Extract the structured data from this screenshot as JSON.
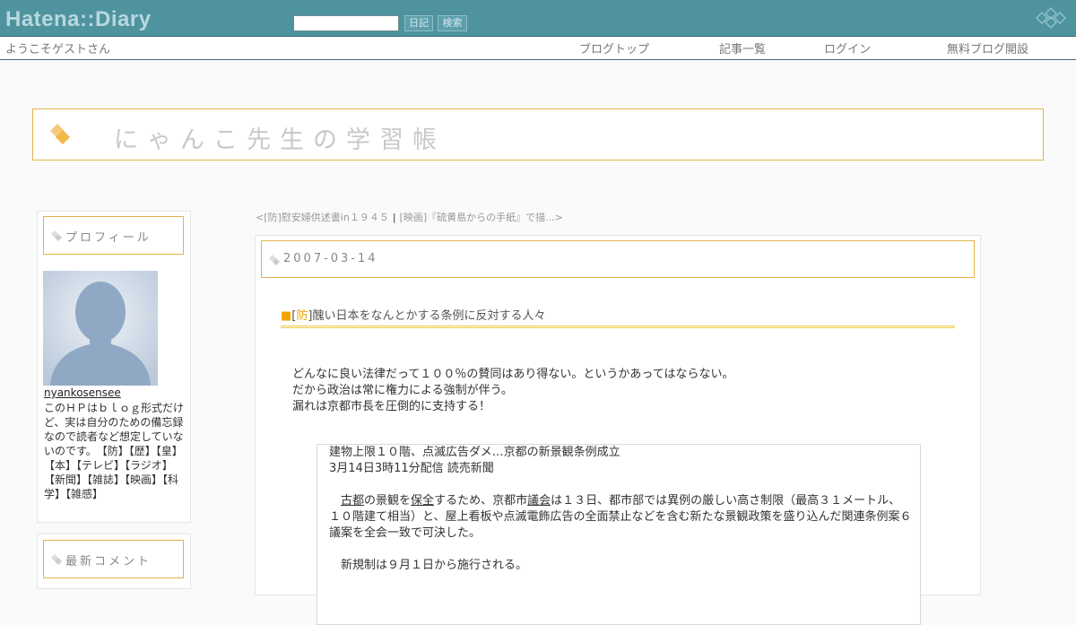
{
  "topbar": {
    "logo": "Hatena::Diary",
    "search_placeholder": "",
    "diary_button": "日記",
    "search_button": "検索"
  },
  "subnav": {
    "welcome": "ようこそゲストさん",
    "links": [
      "ブログトップ",
      "記事一覧",
      "ログイン",
      "無料ブログ開設"
    ]
  },
  "blog": {
    "title": "にゃんこ先生の学習帳"
  },
  "sidebar": {
    "profile_heading": "プロフィール",
    "username": "nyankosensee",
    "bio": "このＨＰはｂｌｏｇ形式だけど、実は自分のための備忘録なので読者など想定していないのです。　【防】【歴】【皇】【本】【テレビ】【ラジオ】【新聞】【雑誌】【映画】【科学】【雑感】",
    "recent_comments_heading": "最新コメント"
  },
  "nav": {
    "prev": "<[防]慰安婦供述書in１９４５",
    "separator": "|",
    "next": "[映画]『硫黄島からの手紙』で描...>"
  },
  "entry": {
    "date": "2007-03-14",
    "title_marker": "■",
    "title_bracket_open": "[",
    "category": "防",
    "title_bracket_close": "]",
    "title": "醜い日本をなんとかする条例に反対する人々",
    "body": [
      "どんなに良い法律だって１００％の賛同はあり得ない。というかあってはならない。",
      "だから政治は常に権力による強制が伴う。",
      "漏れは京都市長を圧倒的に支持する！"
    ],
    "quote": {
      "headline": "建物上限１０階、点滅広告ダメ…京都の新景観条例成立",
      "dateline": "3月14日3時11分配信 読売新聞",
      "p1_link1": "古都",
      "p1_text1": "の景観を",
      "p1_link2": "保全",
      "p1_text2": "するため、京都市",
      "p1_link3": "議会",
      "p1_text3": "は１３日、都市部では異例の厳しい高さ制限（最高３１メートル、１０階建て相当）と、屋上看板や点滅電飾広告の全面禁止などを含む新たな景観政策を盛り込んだ関連条例案６議案を全会一致で可決した。",
      "p2": "新規制は９月１日から施行される。"
    }
  },
  "colors": {
    "topbar": "#4f939f",
    "accent_border": "#e3b34a",
    "category": "#f2a300"
  }
}
